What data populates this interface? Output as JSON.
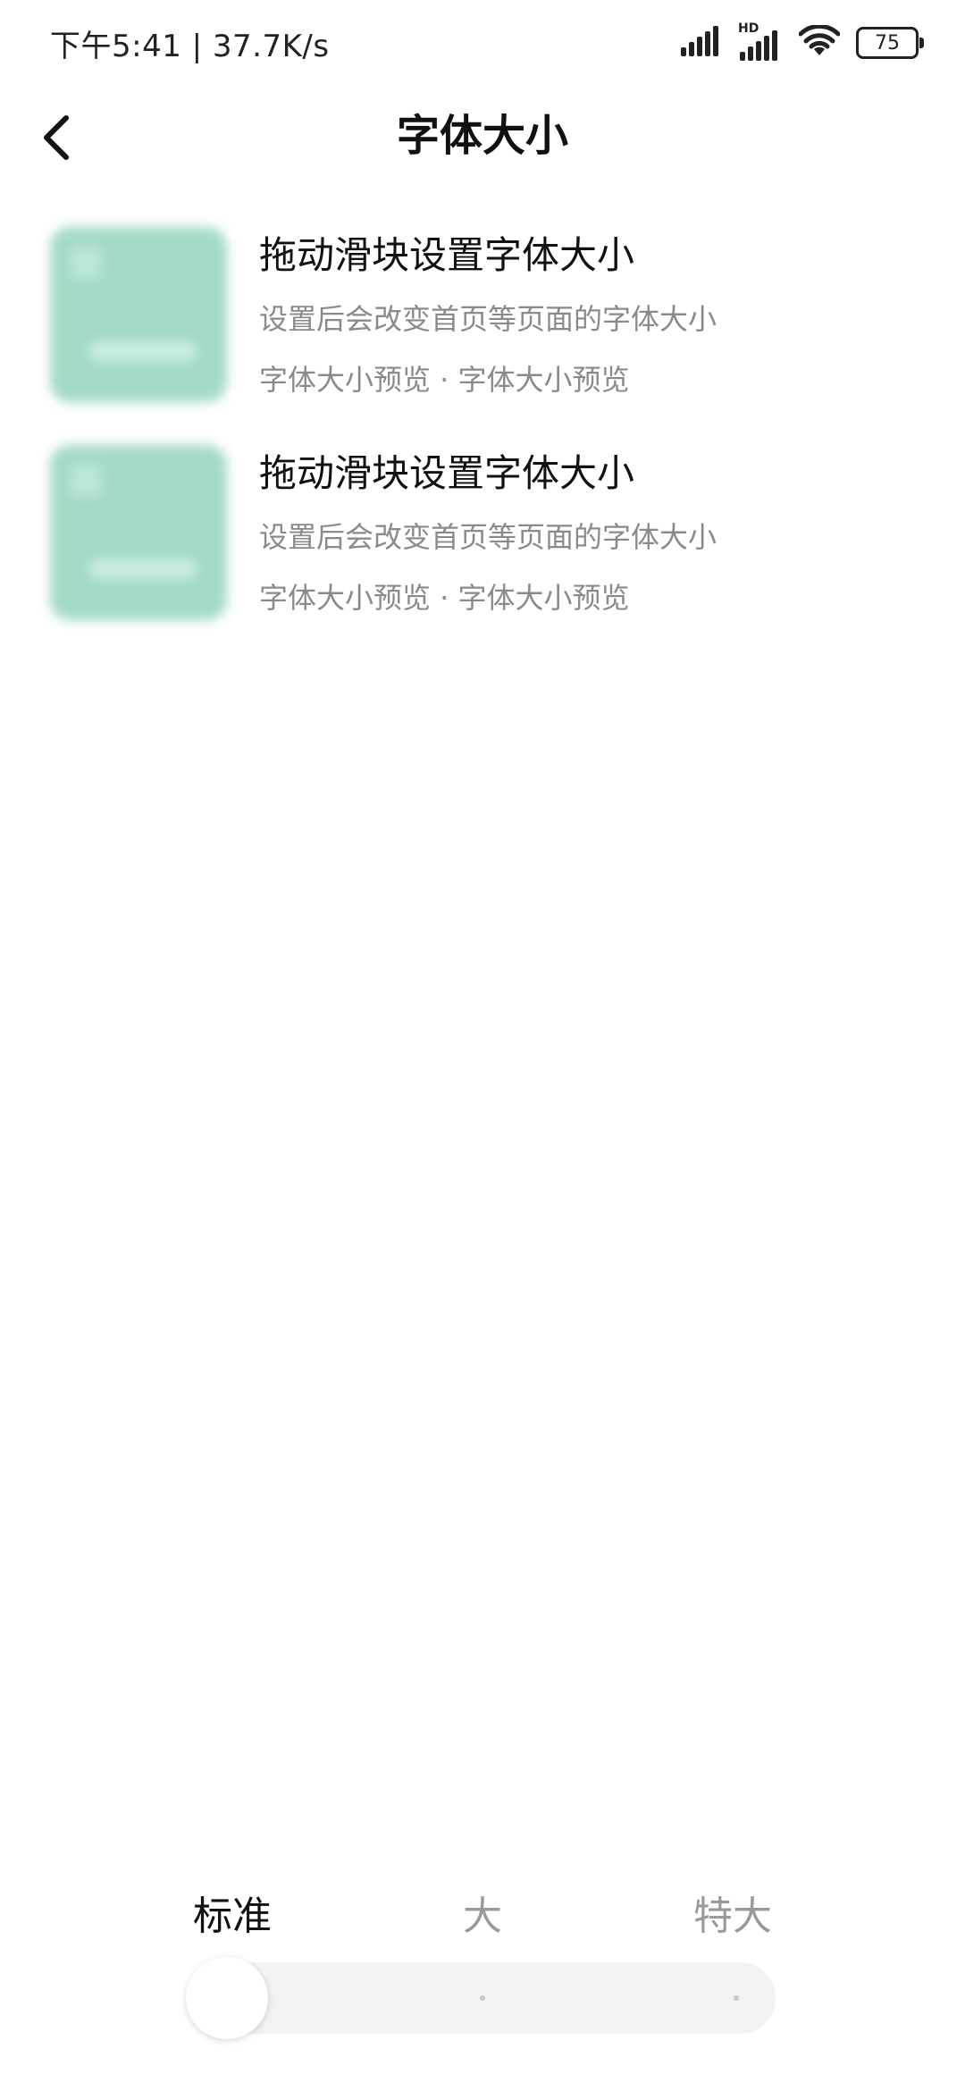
{
  "status_bar": {
    "time_speed": "下午5:41 | 37.7K/s",
    "battery": "75",
    "hd_label": "HD"
  },
  "header": {
    "title": "字体大小"
  },
  "preview_items": [
    {
      "title": "拖动滑块设置字体大小",
      "subtitle": "设置后会改变首页等页面的字体大小",
      "meta": "字体大小预览 · 字体大小预览"
    },
    {
      "title": "拖动滑块设置字体大小",
      "subtitle": "设置后会改变首页等页面的字体大小",
      "meta": "字体大小预览 · 字体大小预览"
    }
  ],
  "slider": {
    "labels": [
      "标准",
      "大",
      "特大"
    ],
    "selected_index": 0
  },
  "colors": {
    "thumbnail": "#9fd9c3",
    "text_primary": "#111111",
    "text_secondary": "#8a8a8a",
    "track": "#f2f2f2"
  },
  "icons": {
    "back": "chevron-left-icon",
    "signal": "signal-icon",
    "wifi": "wifi-icon",
    "battery": "battery-icon"
  }
}
